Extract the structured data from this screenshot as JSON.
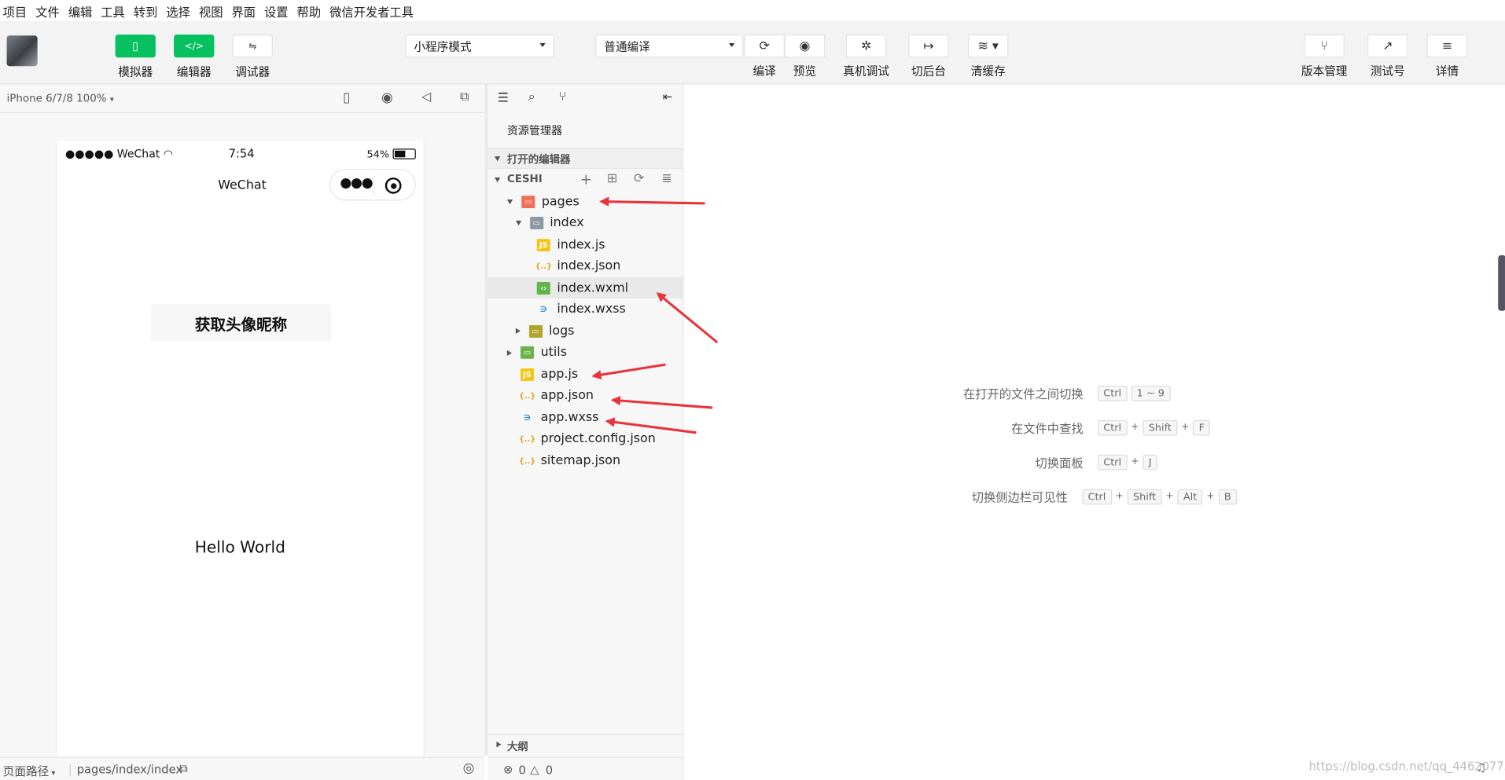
{
  "menu": [
    "项目",
    "文件",
    "编辑",
    "工具",
    "转到",
    "选择",
    "视图",
    "界面",
    "设置",
    "帮助",
    "微信开发者工具"
  ],
  "toolbar": {
    "simulator": "模拟器",
    "editor": "编辑器",
    "debugger": "调试器",
    "mode_select": "小程序模式",
    "compile_select": "普通编译",
    "compile": "编译",
    "preview": "预览",
    "remote_debug": "真机调试",
    "background": "切后台",
    "clear_cache": "清缓存",
    "version_mgmt": "版本管理",
    "test_account": "测试号",
    "details": "详情"
  },
  "simulator": {
    "device": "iPhone 6/7/8 100%",
    "status_signal": "●●●●● WeChat",
    "status_time": "7:54",
    "status_battery": "54%",
    "nav_title": "WeChat",
    "button_label": "获取头像昵称",
    "hello_text": "Hello World"
  },
  "explorer": {
    "title": "资源管理器",
    "open_editors": "打开的编辑器",
    "project": "CESHI",
    "tree": [
      {
        "label": "pages",
        "type": "folder-red",
        "arrow": "down",
        "indent": 0
      },
      {
        "label": "index",
        "type": "folder-gray",
        "arrow": "down",
        "indent": 1
      },
      {
        "label": "index.js",
        "type": "js",
        "arrow": "",
        "indent": 2
      },
      {
        "label": "index.json",
        "type": "json",
        "arrow": "",
        "indent": 2
      },
      {
        "label": "index.wxml",
        "type": "wxml",
        "arrow": "",
        "indent": 2
      },
      {
        "label": "index.wxss",
        "type": "wxss",
        "arrow": "",
        "indent": 2
      },
      {
        "label": "logs",
        "type": "folder-olive",
        "arrow": "right",
        "indent": 1
      },
      {
        "label": "utils",
        "type": "folder-green",
        "arrow": "right",
        "indent": 0
      },
      {
        "label": "app.js",
        "type": "js",
        "arrow": "",
        "indent": 0
      },
      {
        "label": "app.json",
        "type": "json",
        "arrow": "",
        "indent": 0
      },
      {
        "label": "app.wxss",
        "type": "wxss",
        "arrow": "",
        "indent": 0
      },
      {
        "label": "project.config.json",
        "type": "json",
        "arrow": "",
        "indent": 0
      },
      {
        "label": "sitemap.json",
        "type": "json",
        "arrow": "",
        "indent": 0
      }
    ],
    "selected": "index.wxml",
    "outline": "大纲",
    "errors": "0",
    "warnings": "0"
  },
  "shortcuts": [
    {
      "label": "在打开的文件之间切换",
      "keys": [
        "Ctrl",
        "1 ~ 9"
      ],
      "joined": false
    },
    {
      "label": "在文件中查找",
      "keys": [
        "Ctrl",
        "Shift",
        "F"
      ],
      "joined": true
    },
    {
      "label": "切换面板",
      "keys": [
        "Ctrl",
        "J"
      ],
      "joined": true
    },
    {
      "label": "切换侧边栏可见性",
      "keys": [
        "Ctrl",
        "Shift",
        "Alt",
        "B"
      ],
      "joined": true
    }
  ],
  "statusbar": {
    "page_path_label": "页面路径",
    "page_path": "pages/index/index"
  },
  "watermark": "https://blog.csdn.net/qq_44620773",
  "colors": {
    "accent_green": "#07c160",
    "arrow_red": "#e8333b"
  }
}
